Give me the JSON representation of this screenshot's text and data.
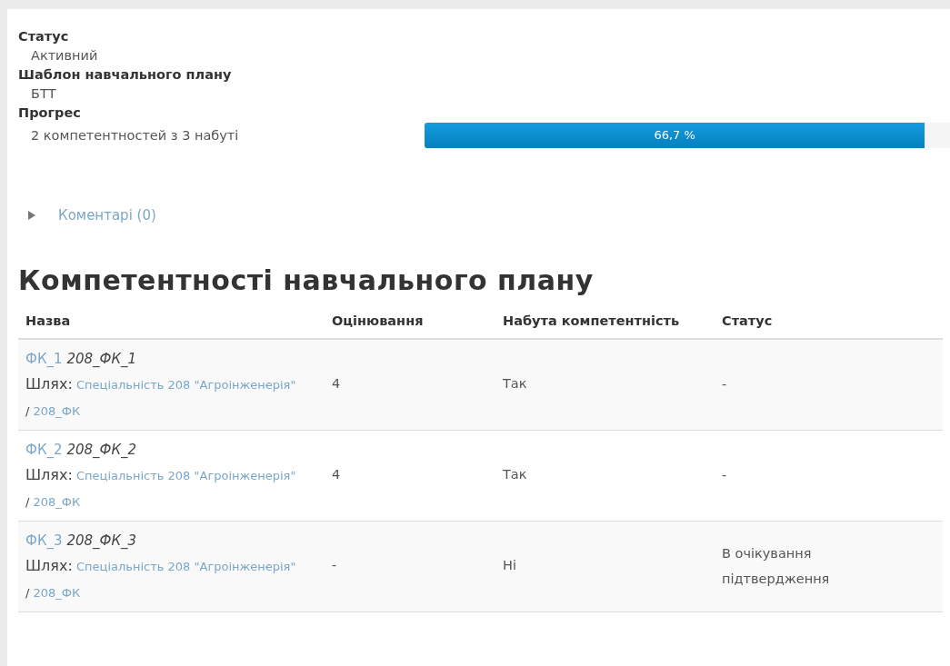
{
  "details": [
    {
      "label": "Статус",
      "value": "Активний"
    },
    {
      "label": "Шаблон навчального плану",
      "value": "БТТ"
    }
  ],
  "progress": {
    "label": "Прогрес",
    "text": "2 компетентностей з 3 набуті",
    "level": 0.667,
    "reading": "66,7 %"
  },
  "comments": {
    "label": "Коментарі (0)",
    "expanded": false
  },
  "heading": "Компетентності навчального плану",
  "table": {
    "columns": [
      "Назва",
      "Оцінювання",
      "Набута компетентність",
      "Статус"
    ],
    "rows": [
      {
        "id_name": "ФК_1",
        "short_name": "208_ФК_1",
        "path_label": "Шлях:",
        "path_links": [
          "Спеціальність 208 \"Агроінженерія\"",
          "208_ФК"
        ],
        "path_separator": "/",
        "rating": "4",
        "proficient": "Так",
        "status": "-"
      },
      {
        "id_name": "ФК_2",
        "short_name": "208_ФК_2",
        "path_label": "Шлях:",
        "path_links": [
          "Спеціальність 208 \"Агроінженерія\"",
          "208_ФК"
        ],
        "path_separator": "/",
        "rating": "4",
        "proficient": "Так",
        "status": "-"
      },
      {
        "id_name": "ФК_3",
        "short_name": "208_ФК_3",
        "path_label": "Шлях:",
        "path_links": [
          "Спеціальність 208 \"Агроінженерія\"",
          "208_ФК"
        ],
        "path_separator": "/",
        "rating": "-",
        "proficient": "Ні",
        "status": "В очікування підтвердження"
      }
    ]
  }
}
